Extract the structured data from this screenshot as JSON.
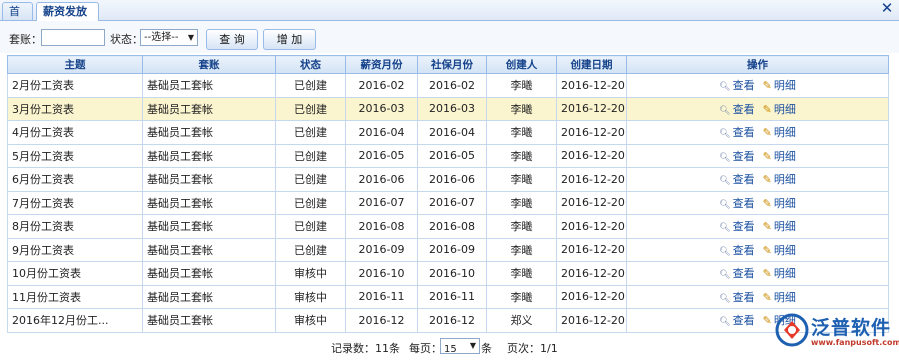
{
  "tabs": [
    {
      "label": "首页"
    },
    {
      "label": "薪资发放",
      "close": "✕"
    }
  ],
  "window_close": "✕",
  "toolbar": {
    "account_label": "套账：",
    "account_value": "",
    "status_label": "状态：",
    "status_value": "--选择--",
    "query_button": "查 询",
    "add_button": "增 加"
  },
  "table": {
    "columns": [
      "主题",
      "套账",
      "状态",
      "薪资月份",
      "社保月份",
      "创建人",
      "创建日期",
      "操作"
    ],
    "rows": [
      {
        "subject": "2月份工资表",
        "account": "基础员工套帐",
        "status": "已创建",
        "salary_month": "2016-02",
        "social_month": "2016-02",
        "creator": "李曦",
        "date": "2016-12-20"
      },
      {
        "subject": "3月份工资表",
        "account": "基础员工套帐",
        "status": "已创建",
        "salary_month": "2016-03",
        "social_month": "2016-03",
        "creator": "李曦",
        "date": "2016-12-20"
      },
      {
        "subject": "4月份工资表",
        "account": "基础员工套帐",
        "status": "已创建",
        "salary_month": "2016-04",
        "social_month": "2016-04",
        "creator": "李曦",
        "date": "2016-12-20"
      },
      {
        "subject": "5月份工资表",
        "account": "基础员工套帐",
        "status": "已创建",
        "salary_month": "2016-05",
        "social_month": "2016-05",
        "creator": "李曦",
        "date": "2016-12-20"
      },
      {
        "subject": "6月份工资表",
        "account": "基础员工套帐",
        "status": "已创建",
        "salary_month": "2016-06",
        "social_month": "2016-06",
        "creator": "李曦",
        "date": "2016-12-20"
      },
      {
        "subject": "7月份工资表",
        "account": "基础员工套帐",
        "status": "已创建",
        "salary_month": "2016-07",
        "social_month": "2016-07",
        "creator": "李曦",
        "date": "2016-12-20"
      },
      {
        "subject": "8月份工资表",
        "account": "基础员工套帐",
        "status": "已创建",
        "salary_month": "2016-08",
        "social_month": "2016-08",
        "creator": "李曦",
        "date": "2016-12-20"
      },
      {
        "subject": "9月份工资表",
        "account": "基础员工套帐",
        "status": "已创建",
        "salary_month": "2016-09",
        "social_month": "2016-09",
        "creator": "李曦",
        "date": "2016-12-20"
      },
      {
        "subject": "10月份工资表",
        "account": "基础员工套帐",
        "status": "审核中",
        "salary_month": "2016-10",
        "social_month": "2016-10",
        "creator": "李曦",
        "date": "2016-12-20"
      },
      {
        "subject": "11月份工资表",
        "account": "基础员工套帐",
        "status": "审核中",
        "salary_month": "2016-11",
        "social_month": "2016-11",
        "creator": "李曦",
        "date": "2016-12-20"
      },
      {
        "subject": "2016年12月份工...",
        "account": "基础员工套帐",
        "status": "审核中",
        "salary_month": "2016-12",
        "social_month": "2016-12",
        "creator": "郑义",
        "date": "2016-12-20"
      }
    ],
    "action_view": "查看",
    "action_detail": "明细",
    "highlight_row": 1
  },
  "pager": {
    "records_label": "记录数：11条",
    "per_page_label": "每页：",
    "per_page_value": "15",
    "unit": "条",
    "page_label": "页次：1/1"
  },
  "logo": {
    "text": "泛普软件",
    "url": "www.fanpusoft.com"
  },
  "icons": {
    "view": "magnifier-icon",
    "detail": "pencil-icon"
  },
  "colors": {
    "header_text": "#15428b",
    "border": "#99bbe8",
    "highlight_row": "#fbf5cf",
    "link": "#1a4fa0",
    "logo": "#1d5fb0"
  }
}
